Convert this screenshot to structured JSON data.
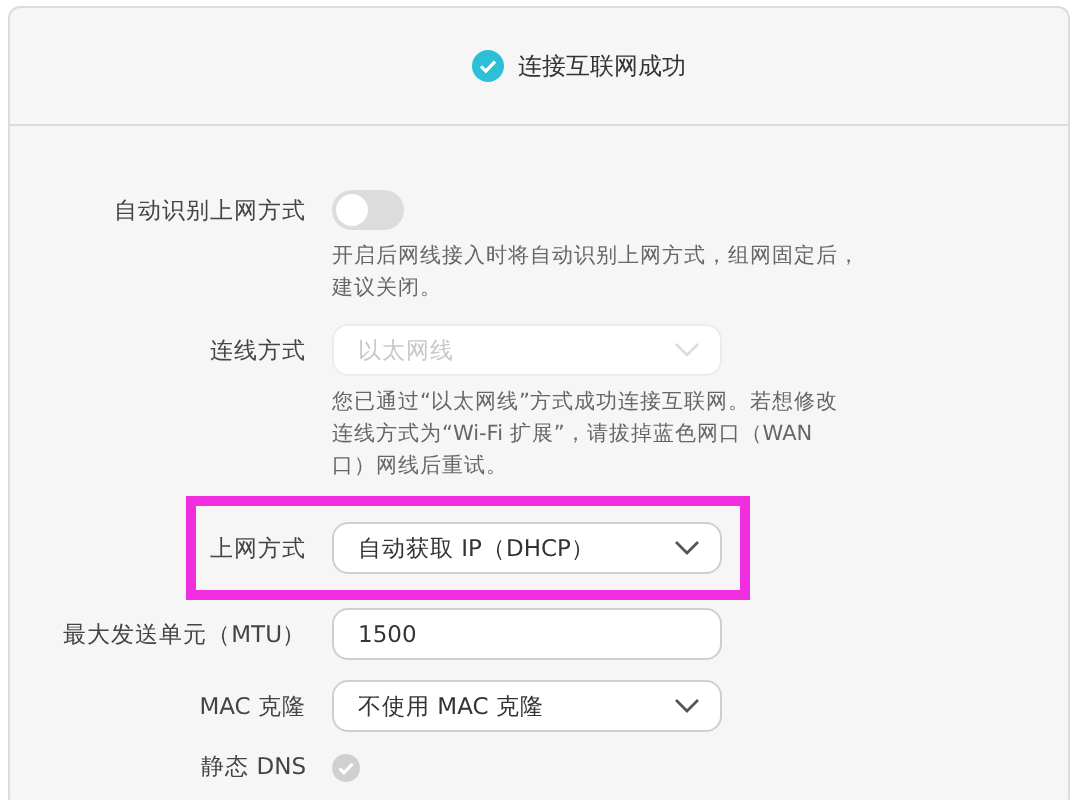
{
  "status": {
    "text": "连接互联网成功",
    "connected": true
  },
  "rows": [
    {
      "kind": "toggle",
      "label": "自动识别上网方式",
      "on": false,
      "hint": [
        "开启后网线接入时将自动识别上网方式，组网固定后，",
        "建议关闭。"
      ]
    },
    {
      "kind": "select",
      "label": "连线方式",
      "value": "以太网线",
      "disabled": true,
      "hint": [
        "您已通过“以太网线”方式成功连接互联网。若想修改",
        "连线方式为“Wi-Fi 扩展”，请拔掉蓝色网口（WAN",
        "口）网线后重试。"
      ]
    },
    {
      "kind": "select",
      "label": "上网方式",
      "value": "自动获取 IP（DHCP）",
      "disabled": false,
      "highlighted": true
    },
    {
      "kind": "input",
      "label": "最大发送单元（MTU）",
      "value": "1500"
    },
    {
      "kind": "select",
      "label": "MAC 克隆",
      "value": "不使用 MAC 克隆",
      "disabled": false
    },
    {
      "kind": "check",
      "label": "静态 DNS",
      "checked": true,
      "disabled": true
    }
  ]
}
